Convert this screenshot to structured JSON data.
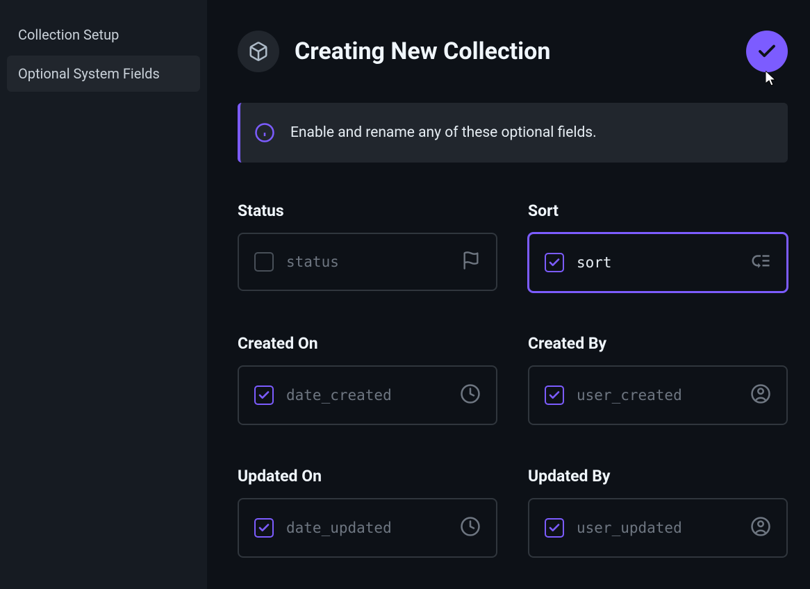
{
  "sidebar": {
    "items": [
      {
        "label": "Collection Setup",
        "active": false
      },
      {
        "label": "Optional System Fields",
        "active": true
      }
    ]
  },
  "header": {
    "title": "Creating New Collection"
  },
  "info": {
    "text": "Enable and rename any of these optional fields."
  },
  "fields": [
    {
      "label": "Status",
      "placeholder": "status",
      "checked": false,
      "selected": false,
      "icon": "flag"
    },
    {
      "label": "Sort",
      "placeholder": "sort",
      "checked": true,
      "selected": true,
      "icon": "low-priority"
    },
    {
      "label": "Created On",
      "placeholder": "date_created",
      "checked": true,
      "selected": false,
      "icon": "clock"
    },
    {
      "label": "Created By",
      "placeholder": "user_created",
      "checked": true,
      "selected": false,
      "icon": "person"
    },
    {
      "label": "Updated On",
      "placeholder": "date_updated",
      "checked": true,
      "selected": false,
      "icon": "clock"
    },
    {
      "label": "Updated By",
      "placeholder": "user_updated",
      "checked": true,
      "selected": false,
      "icon": "person"
    }
  ]
}
